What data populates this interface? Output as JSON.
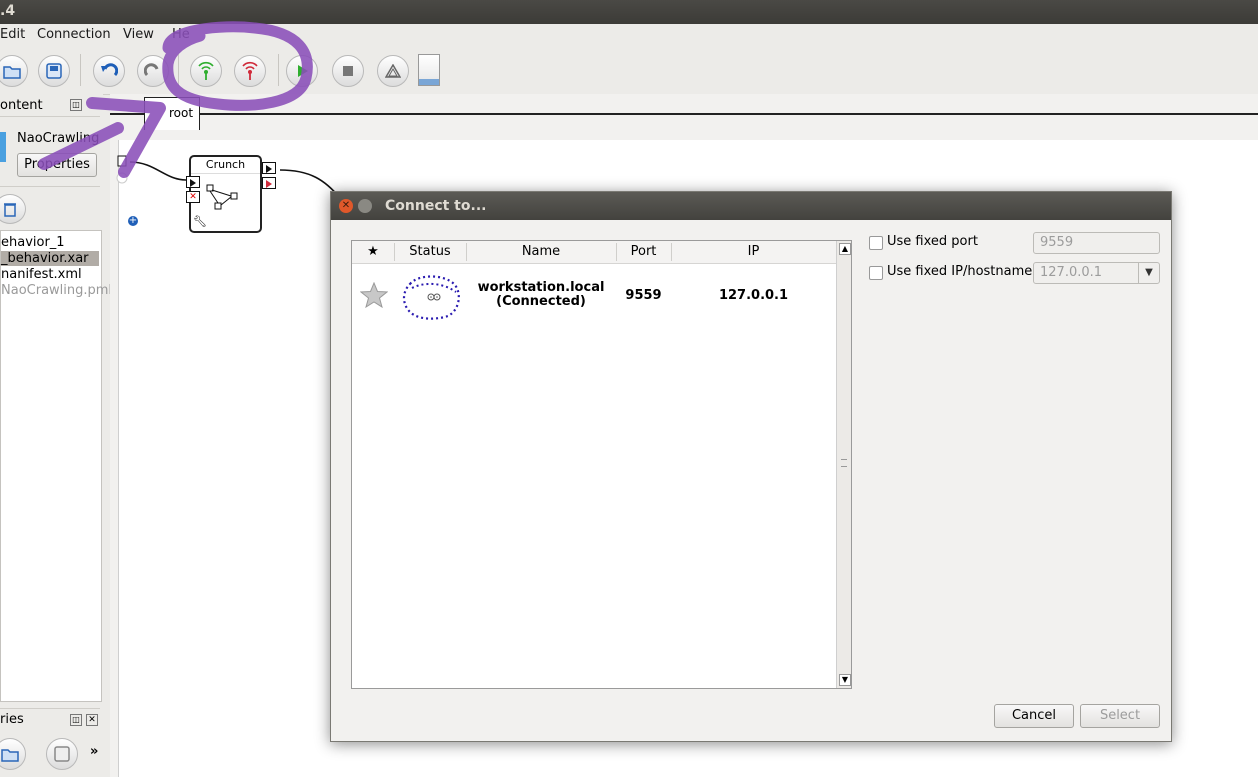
{
  "window": {
    "title": ".4"
  },
  "menu": {
    "items": [
      "Edit",
      "Connection",
      "View",
      "He"
    ]
  },
  "left_panel": {
    "content_title": "ontent",
    "project_name": "NaoCrawling",
    "properties_label": "Properties",
    "tree": [
      "ehavior_1",
      "_behavior.xar",
      "nanifest.xml",
      "NaoCrawling.pml"
    ],
    "libraries_title": "ries",
    "more_label": "»"
  },
  "canvas": {
    "tab_label": "root",
    "box_label": "Crunch"
  },
  "dialog": {
    "title": "Connect to...",
    "columns": {
      "star": "★",
      "status": "Status",
      "name": "Name",
      "port": "Port",
      "ip": "IP"
    },
    "rows": [
      {
        "name_line1": "workstation.local",
        "name_line2": "(Connected)",
        "port": "9559",
        "ip": "127.0.0.1"
      }
    ],
    "fixed_port_label": "Use fixed port",
    "fixed_port_value": "9559",
    "fixed_ip_label": "Use fixed IP/hostname",
    "fixed_ip_value": "127.0.0.1",
    "cancel_label": "Cancel",
    "select_label": "Select"
  },
  "colors": {
    "annotation": "#8a4fb8",
    "titlebar": "#3c3b37",
    "accent": "#e95420"
  }
}
